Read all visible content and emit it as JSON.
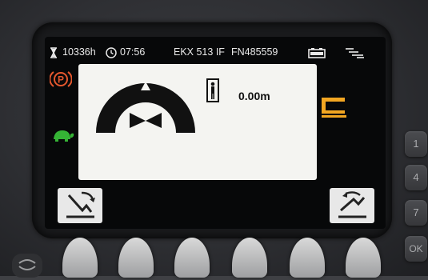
{
  "status_bar": {
    "hours_icon": "hourglass-icon",
    "hours": "10336h",
    "clock_icon": "clock-icon",
    "time": "07:56",
    "model": "EKX 513 IF",
    "serial": "FN485559",
    "battery_icon": "battery-icon",
    "menu_icon": "stacked-lines-icon"
  },
  "indicators": {
    "parking_brake": {
      "icon": "parking-brake-icon",
      "color": "#e4572e"
    },
    "slow_speed": {
      "icon": "turtle-icon",
      "color": "#35b335"
    },
    "fork_icon": {
      "icon": "fork-level-icon",
      "color": "#f2a622"
    }
  },
  "main_panel": {
    "steering_icon": "steering-angle-icon",
    "operator_icon": "operator-platform-icon",
    "lift_height": "0.00m"
  },
  "buttons": {
    "left": "tilt-down-icon",
    "right": "tilt-up-icon"
  },
  "keypad": [
    "1",
    "4",
    "7",
    "OK"
  ],
  "softkeys_count": 6,
  "colors": {
    "screen": "#070809",
    "panel": "#f4f4f1",
    "accent": "#f2a622"
  }
}
